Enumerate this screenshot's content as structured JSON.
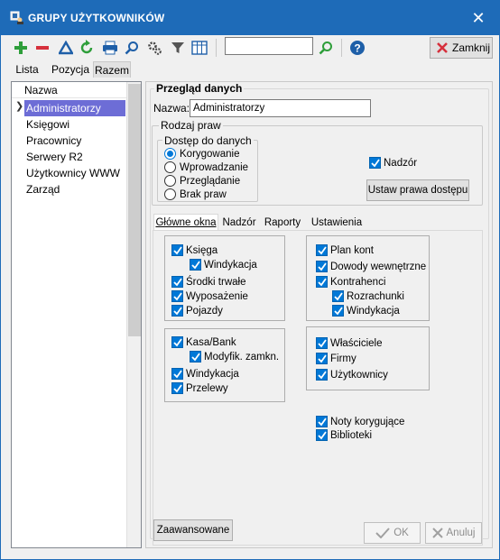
{
  "window": {
    "title": "GRUPY UŻYTKOWNIKÓW",
    "close_glyph": "✕"
  },
  "toolbar": {
    "close_label": "Zamknij",
    "search_value": "",
    "icons": [
      "add-icon",
      "remove-icon",
      "filter-triangle-icon",
      "refresh-icon",
      "print-icon",
      "search-icon",
      "settings-icon",
      "funnel-icon",
      "columns-icon",
      "find-icon",
      "help-icon"
    ]
  },
  "tabs": [
    {
      "label": "Lista"
    },
    {
      "label": "Pozycja"
    },
    {
      "label": "Razem"
    }
  ],
  "list": {
    "header": "Nazwa",
    "items": [
      "Administratorzy",
      "Księgowi",
      "Pracownicy",
      "Serwery R2",
      "Użytkownicy WWW",
      "Zarząd"
    ],
    "selected": "Administratorzy"
  },
  "detail": {
    "title": "Przegląd danych",
    "name_label": "Nazwa:",
    "name_value": "Administratorzy",
    "rights_group": "Rodzaj praw",
    "access_group": "Dostęp do danych",
    "access_options": [
      "Korygowanie",
      "Wprowadzanie",
      "Przeglądanie",
      "Brak praw"
    ],
    "access_selected": "Korygowanie",
    "supervision_label": "Nadzór",
    "set_rights_button": "Ustaw prawa dostępu",
    "subtabs": [
      "Główne okna",
      "Nadzór",
      "Raporty",
      "Ustawienia"
    ],
    "boxes": {
      "ksiega": [
        "Księga",
        "Windykacja",
        "Środki trwałe",
        "Wyposażenie",
        "Pojazdy"
      ],
      "kasa": [
        "Kasa/Bank",
        "Modyfik. zamkn.",
        "Windykacja",
        "Przelewy"
      ],
      "plan": [
        "Plan kont",
        "Dowody wewnętrzne",
        "Kontrahenci",
        "Rozrachunki",
        "Windykacja"
      ],
      "firmy": [
        "Właściciele",
        "Firmy",
        "Użytkownicy"
      ],
      "noty": [
        "Noty korygujące",
        "Biblioteki"
      ]
    },
    "advanced_button": "Zaawansowane",
    "ok_button": "OK",
    "cancel_button": "Anuluj"
  },
  "colors": {
    "title_bar": "#1e6bb8",
    "selection": "#6d6dd6",
    "checkbox": "#0078d7"
  }
}
